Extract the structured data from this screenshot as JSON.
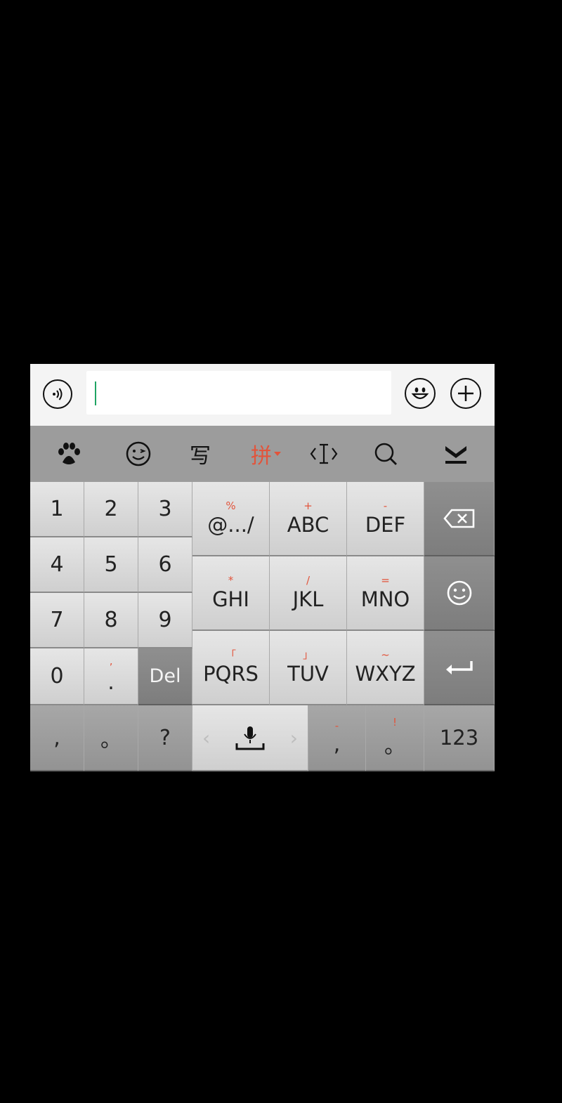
{
  "toolbar": {
    "pinyin_label": "拼",
    "handwrite_label": "写",
    "accent": "#e2543b"
  },
  "numpad": [
    "1",
    "2",
    "3",
    "4",
    "5",
    "6",
    "7",
    "8",
    "9",
    "0"
  ],
  "dot_key": {
    "sym": "’",
    "main": "."
  },
  "del_label": "Del",
  "t9_keys": [
    {
      "sym": "%",
      "main": "@.../"
    },
    {
      "sym": "+",
      "main": "ABC"
    },
    {
      "sym": "-",
      "main": "DEF"
    },
    {
      "sym": "*",
      "main": "GHI"
    },
    {
      "sym": "/",
      "main": "JKL"
    },
    {
      "sym": "=",
      "main": "MNO"
    },
    {
      "sym": "「",
      "main": "PQRS"
    },
    {
      "sym": "」",
      "main": "TUV"
    },
    {
      "sym": "~",
      "main": "WXYZ"
    }
  ],
  "bottom_row": {
    "comma": ",",
    "period": "。",
    "question": "?",
    "comma2": ",",
    "comma2_sym": "-",
    "period2": "。",
    "period2_sym": "!",
    "mode_label": "123",
    "left_arrow": "‹",
    "right_arrow": "›"
  },
  "icons": [
    "voice-icon",
    "emoji-icon",
    "plus-icon",
    "paw-icon",
    "wink-icon",
    "cursor-icon",
    "search-icon",
    "collapse-icon",
    "backspace-icon",
    "smiley-icon",
    "enter-icon",
    "mic-space-icon"
  ]
}
